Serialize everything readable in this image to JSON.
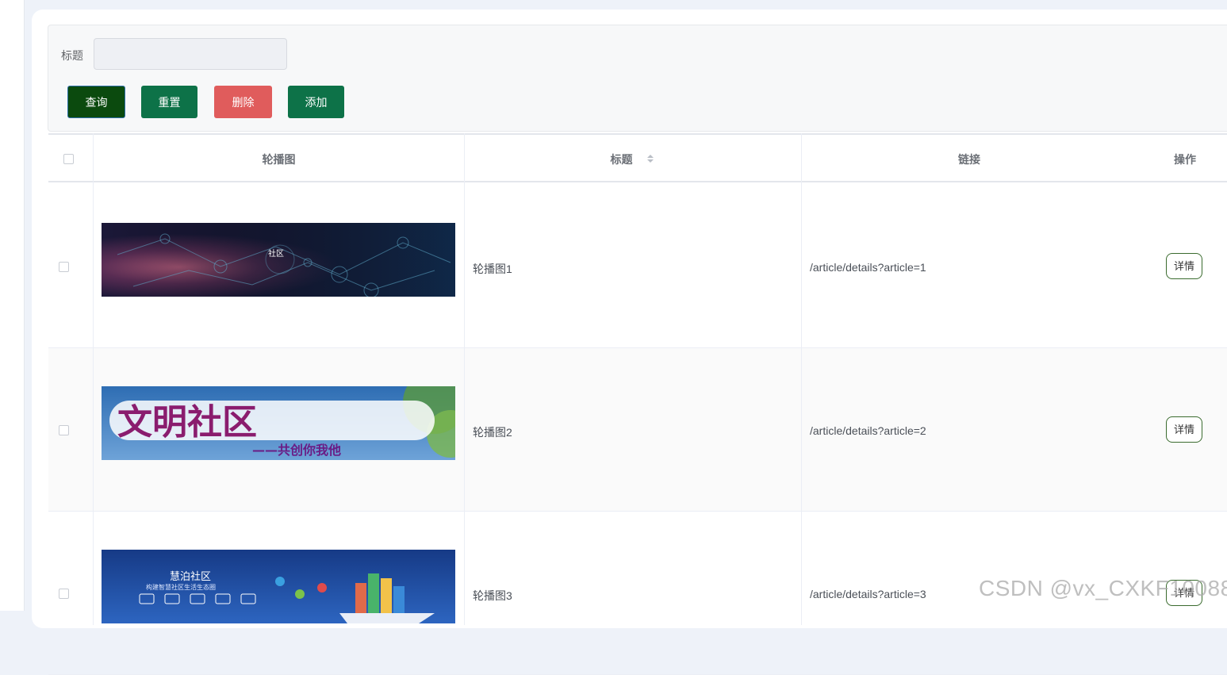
{
  "search": {
    "label": "标题",
    "value": "",
    "placeholder": ""
  },
  "buttons": {
    "query": "查询",
    "reset": "重置",
    "delete": "删除",
    "add": "添加"
  },
  "table": {
    "headers": [
      "轮播图",
      "标题",
      "链接",
      "操作"
    ],
    "rows": [
      {
        "title": "轮播图1",
        "link": "/article/details?article=1",
        "action": "详情",
        "banner_text": "社区"
      },
      {
        "title": "轮播图2",
        "link": "/article/details?article=2",
        "action": "详情",
        "banner_text": "文明社区",
        "banner_sub": "——共创你我他"
      },
      {
        "title": "轮播图3",
        "link": "/article/details?article=3",
        "action": "详情",
        "banner_text": "慧泊社区",
        "banner_sub": "构建智慧社区生活生态圈"
      }
    ]
  },
  "watermark": "CSDN @vx_CXKF10088",
  "colors": {
    "query_button": "#0b4a0e",
    "reset_button": "#0d7248",
    "delete_button": "#e05c5c",
    "add_button": "#0d7248"
  }
}
